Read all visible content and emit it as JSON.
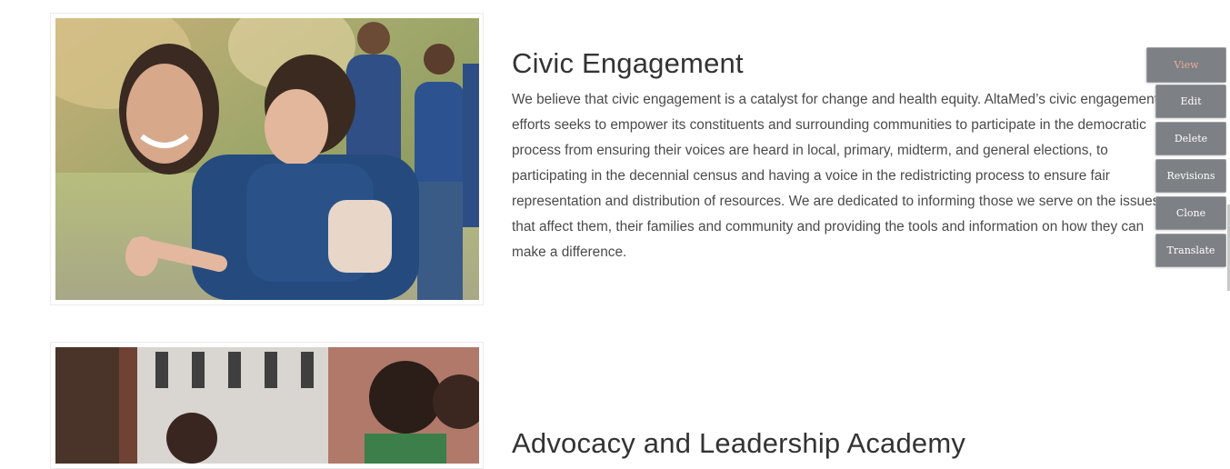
{
  "sections": [
    {
      "title": "Civic Engagement",
      "body": "We believe that civic engagement is a catalyst for change and health equity. AltaMed’s civic engagement efforts seeks to empower its constituents and surrounding communities to participate in the democratic process from ensuring their voices are heard in local, primary, midterm, and general elections, to participating in the decennial census and having a voice in the redistricting process to ensure fair representation and distribution of resources. We are dedicated to informing those we serve on the issues that affect them, their families and community and providing the tools and information on how they can make a difference."
    },
    {
      "title": "Advocacy and Leadership Academy"
    }
  ],
  "admin_menu": {
    "view": "View",
    "edit": "Edit",
    "delete": "Delete",
    "revisions": "Revisions",
    "clone": "Clone",
    "translate": "Translate"
  },
  "colors": {
    "button_bg": "#7d8084",
    "view_text": "#e9a99a",
    "title_text": "#333333",
    "body_text": "#4a4a4a"
  }
}
